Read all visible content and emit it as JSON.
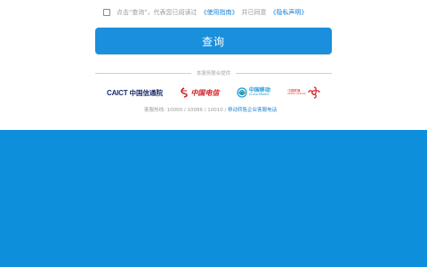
{
  "agreement": {
    "prefix": "点击\"查询\"，代表您已阅读过",
    "terms_link": "《使用指南》",
    "middle": "并已同意",
    "privacy_link": "《隐私声明》"
  },
  "query_button": {
    "label": "查询"
  },
  "support": {
    "caption": "本服务联合提供"
  },
  "logos": {
    "caict_en": "CAICT",
    "caict_cn": "中国信通院",
    "telecom_cn": "中国电信",
    "mobile_cn": "中国移动",
    "mobile_en": "China Mobile",
    "unicom_cn": "中国联通",
    "unicom_en": "China unicom"
  },
  "hotline": {
    "text": "客服热线: 10000 / 10086 / 10010 / ",
    "link": "移动转售企业客服电话"
  },
  "colors": {
    "accent": "#1a8fdc",
    "background_blue": "#0e8fdc",
    "link": "#1a7fd1",
    "caict": "#1b2a6b",
    "telecom": "#d21f26",
    "mobile": "#1e9ad6",
    "unicom": "#d21f26"
  }
}
